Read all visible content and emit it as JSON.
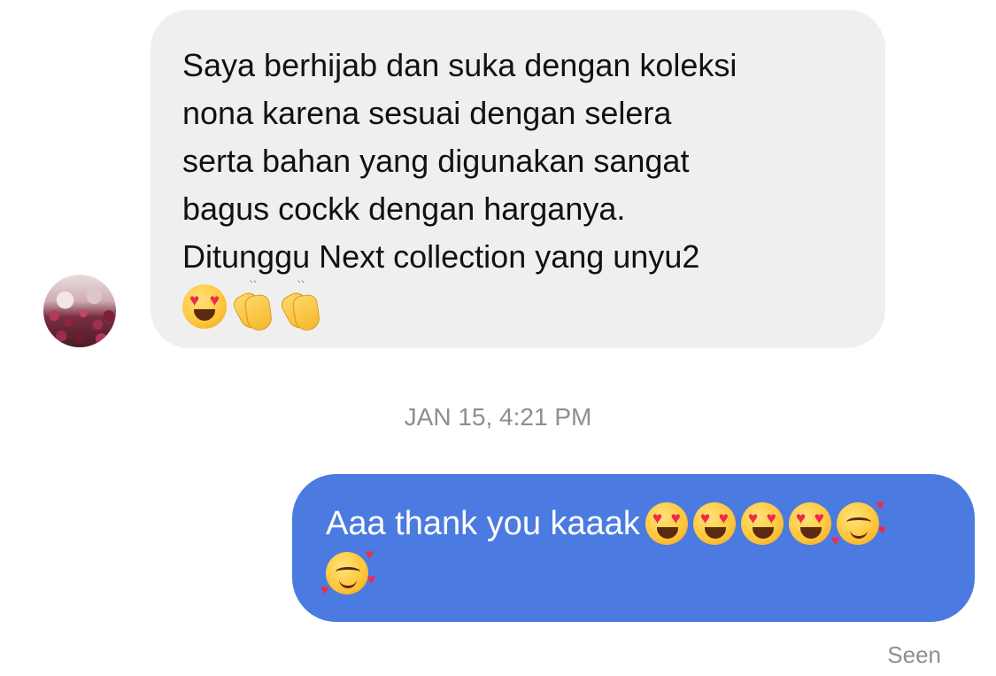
{
  "conversation": {
    "incoming": {
      "text": "Saya berhijab dan suka dengan koleksi\nnona karena sesuai dengan selera\nserta bahan yang digunakan sangat\nbagus cockk dengan harganya.\nDitunggu Next collection yang unyu2",
      "emojis": [
        "😍",
        "👏",
        "👏"
      ]
    },
    "timestamp": "JAN 15, 4:21 PM",
    "outgoing": {
      "text": "Aaa thank you kaaak",
      "emojis": [
        "😍",
        "😍",
        "😍",
        "😍",
        "🥰",
        "🥰"
      ]
    },
    "status": "Seen"
  }
}
